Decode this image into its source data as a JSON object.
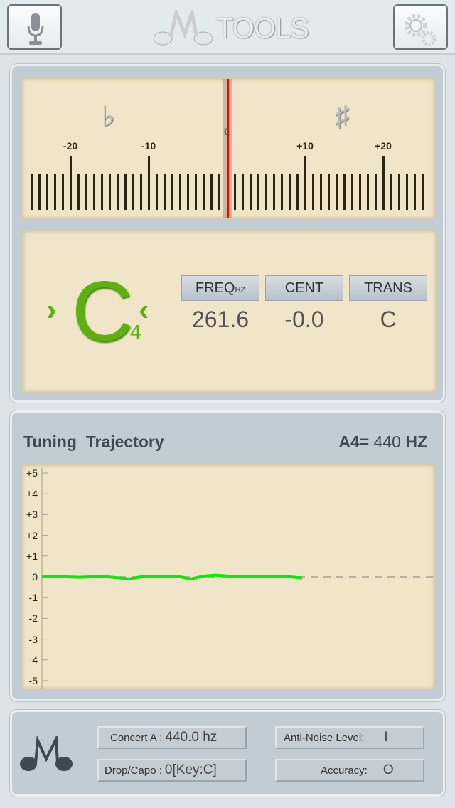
{
  "header": {
    "logo_letter": "M",
    "logo_text": "TOOLS",
    "mic_icon": "microphone-icon",
    "settings_icon": "gears-icon"
  },
  "meter": {
    "flat_symbol": "♭",
    "sharp_symbol": "♯",
    "labels": [
      "-20",
      "-10",
      "0",
      "+10",
      "+20"
    ],
    "range": [
      -25,
      25
    ],
    "needle_cents": 0,
    "needle_color": "#ff0000"
  },
  "note": {
    "name": "C",
    "octave": "4",
    "color": "#5cb010",
    "left_arrow": "›",
    "right_arrow": "‹",
    "columns": [
      {
        "label": "FREQ",
        "sub": "HZ",
        "value": "261.6"
      },
      {
        "label": "CENT",
        "sub": "",
        "value": "-0.0"
      },
      {
        "label": "TRANS",
        "sub": "",
        "value": "C"
      }
    ]
  },
  "trajectory": {
    "title": "Tuning  Trajectory",
    "a4_label": "A4=",
    "a4_value": "440",
    "a4_unit": "HZ",
    "y_labels": [
      "+5",
      "+4",
      "+3",
      "+2",
      "+1",
      "0",
      "-1",
      "-2",
      "-3",
      "-4",
      "-5"
    ],
    "ylim": [
      -5,
      5
    ],
    "line_color": "#00ee00",
    "values": [
      0,
      0.02,
      0,
      -0.02,
      0,
      0.02,
      -0.04,
      -0.1,
      0,
      0.03,
      0,
      0.02,
      -0.1,
      0.03,
      0.08,
      0.04,
      0.02,
      0,
      0.02,
      0.01,
      0,
      -0.05
    ]
  },
  "footer": {
    "concert_label": "Concert A :",
    "concert_value": "440.0 hz",
    "capo_label": "Drop/Capo :",
    "capo_value": "0[Key:C]",
    "noise_label": "Anti-Noise Level:",
    "noise_value": "I",
    "accuracy_label": "Accuracy:",
    "accuracy_value": "O"
  }
}
